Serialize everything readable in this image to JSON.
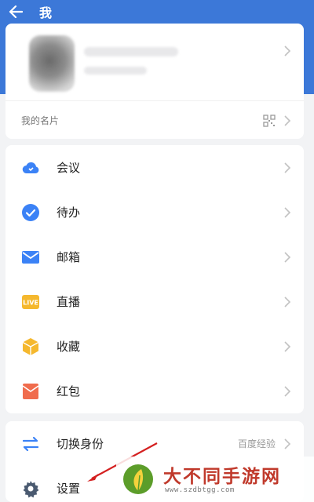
{
  "header": {
    "title": "我",
    "color": "#3c78d8"
  },
  "profile": {
    "my_card_label": "我的名片"
  },
  "menu": {
    "items": [
      {
        "label": "会议",
        "icon": "cloud-icon",
        "color": "#3b82f6"
      },
      {
        "label": "待办",
        "icon": "check-circle-icon",
        "color": "#3b82f6"
      },
      {
        "label": "邮箱",
        "icon": "mail-icon",
        "color": "#3b82f6"
      },
      {
        "label": "直播",
        "icon": "live-icon",
        "color": "#f5b82e"
      },
      {
        "label": "收藏",
        "icon": "box-icon",
        "color": "#f5b82e"
      },
      {
        "label": "红包",
        "icon": "red-envelope-icon",
        "color": "#f06c4d"
      }
    ]
  },
  "bottom": {
    "switch_identity_label": "切换身份",
    "switch_identity_value": "百度经验",
    "settings_label": "设置"
  },
  "watermark": {
    "title": "大不同手游网",
    "url": "www.szdbtgg.com"
  }
}
